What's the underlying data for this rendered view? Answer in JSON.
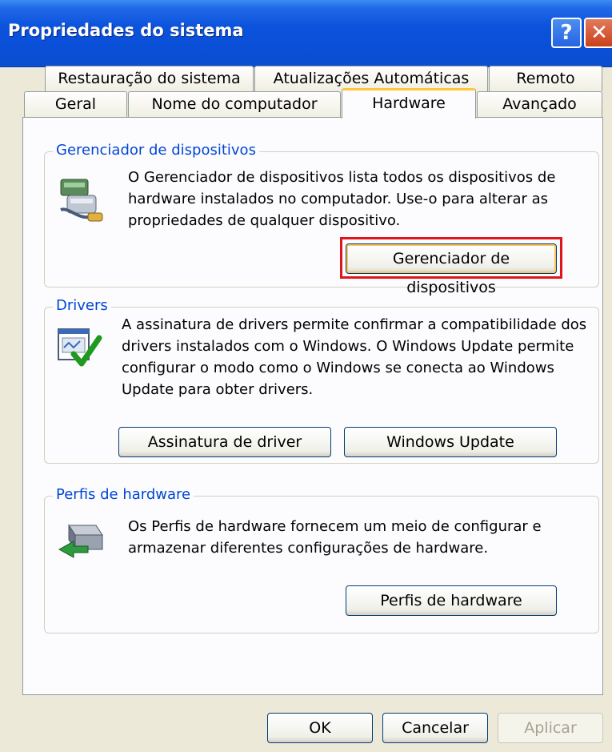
{
  "window": {
    "title": "Propriedades do sistema",
    "help_glyph": "?",
    "close_glyph": "✕"
  },
  "tabs": {
    "row1": [
      "Restauração do sistema",
      "Atualizações Automáticas",
      "Remoto"
    ],
    "row2": [
      "Geral",
      "Nome do computador",
      "Hardware",
      "Avançado"
    ],
    "active": "Hardware"
  },
  "device_manager": {
    "legend": "Gerenciador de dispositivos",
    "lines": [
      "O Gerenciador de dispositivos lista todos os dispositivos de",
      "hardware instalados no computador. Use-o para alterar as",
      "propriedades de qualquer dispositivo."
    ],
    "button": "Gerenciador de dispositivos",
    "icon": "device-manager-icon"
  },
  "drivers": {
    "legend": "Drivers",
    "lines": [
      "A assinatura de drivers permite confirmar a compatibilidade dos",
      "drivers instalados com o Windows. O Windows Update permite",
      "configurar o modo como o Windows se conecta ao Windows",
      "Update para obter drivers."
    ],
    "signing_button": "Assinatura de driver",
    "update_button": "Windows Update",
    "icon": "driver-signing-icon"
  },
  "profiles": {
    "legend": "Perfis de hardware",
    "lines": [
      "Os Perfis de hardware fornecem um meio de configurar e",
      "armazenar diferentes configurações de hardware."
    ],
    "button": "Perfis de hardware",
    "icon": "hardware-profiles-icon"
  },
  "footer": {
    "ok": "OK",
    "cancel": "Cancelar",
    "apply": "Aplicar"
  },
  "colors": {
    "titlebar": "#0a4fd7",
    "legend_text": "#0046d5",
    "active_tab_accent": "#ffc73c",
    "highlight": "#e0161c"
  }
}
